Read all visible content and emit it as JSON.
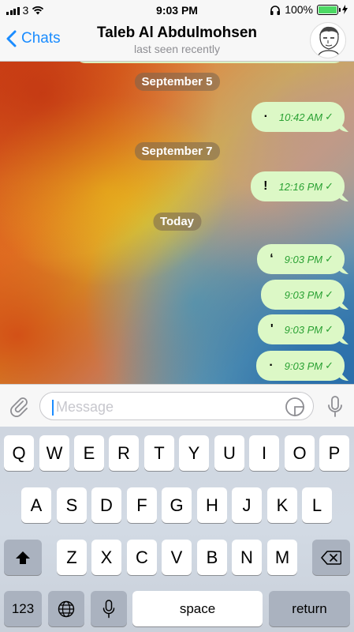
{
  "status_bar": {
    "carrier": "3",
    "time": "9:03 PM",
    "battery_percent": "100%",
    "battery_level": 1.0
  },
  "nav": {
    "back_label": "Chats",
    "title": "Taleb Al Abdulmohsen",
    "subtitle": "last seen recently"
  },
  "chat": {
    "date_separators": [
      "September 5",
      "September 7",
      "Today"
    ],
    "messages": [
      {
        "text": "·",
        "time": "10:42 AM",
        "status": "✓"
      },
      {
        "text": "!",
        "time": "12:16 PM",
        "status": "✓"
      },
      {
        "text": "‘",
        "time": "9:03 PM",
        "status": "✓"
      },
      {
        "text": "",
        "time": "9:03 PM",
        "status": "✓"
      },
      {
        "text": "'",
        "time": "9:03 PM",
        "status": "✓"
      },
      {
        "text": "·",
        "time": "9:03 PM",
        "status": "✓"
      }
    ]
  },
  "input": {
    "placeholder": "Message"
  },
  "keyboard": {
    "row1": [
      "Q",
      "W",
      "E",
      "R",
      "T",
      "Y",
      "U",
      "I",
      "O",
      "P"
    ],
    "row2": [
      "A",
      "S",
      "D",
      "F",
      "G",
      "H",
      "J",
      "K",
      "L"
    ],
    "row3": [
      "Z",
      "X",
      "C",
      "V",
      "B",
      "N",
      "M"
    ],
    "numbers_label": "123",
    "space_label": "space",
    "return_label": "return"
  },
  "colors": {
    "accent": "#1a8cff",
    "bubble": "#dcf8c6",
    "timestamp": "#2aa133"
  }
}
